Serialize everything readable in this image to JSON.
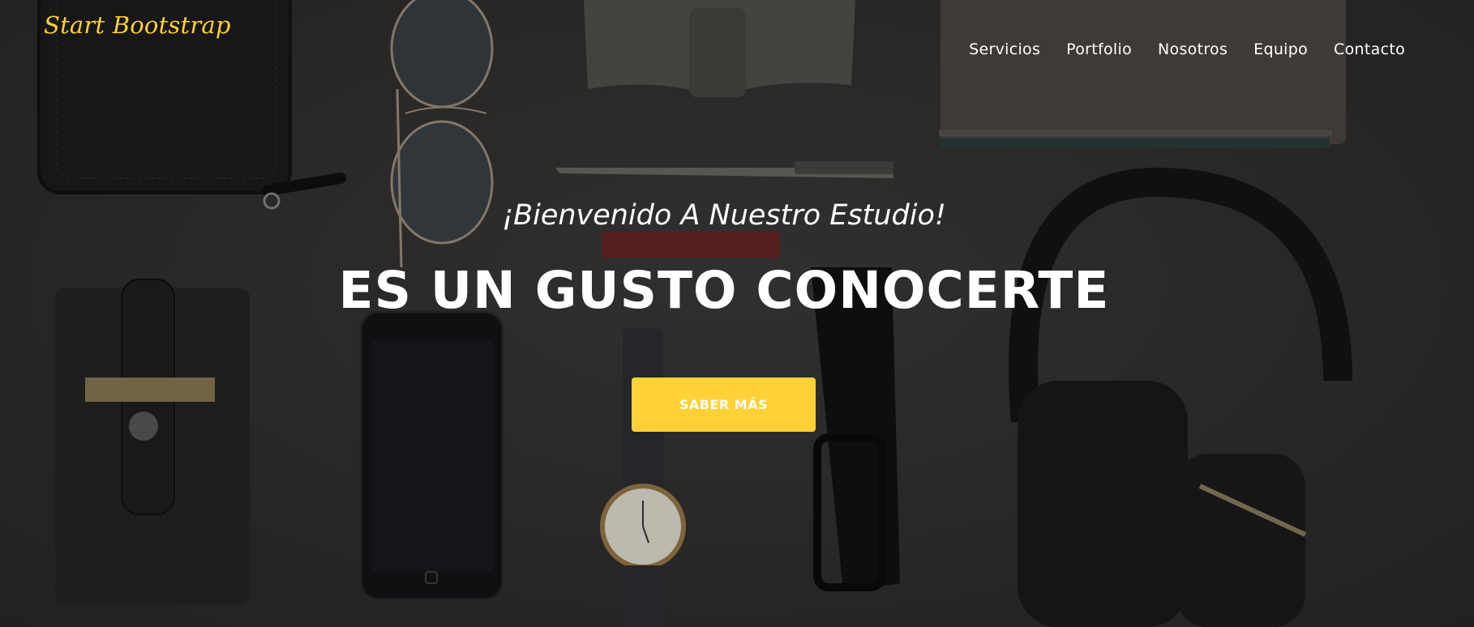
{
  "navbar": {
    "brand": "Start Bootstrap",
    "links": [
      "Servicios",
      "Portfolio",
      "Nosotros",
      "Equipo",
      "Contacto"
    ]
  },
  "hero": {
    "subheading": "¡Bienvenido A Nuestro Estudio!",
    "heading": "ES UN GUSTO CONOCERTE",
    "cta_label": "SABER MÁS"
  },
  "colors": {
    "accent": "#fed136",
    "text": "#ffffff",
    "background": "#2c2b2b"
  }
}
